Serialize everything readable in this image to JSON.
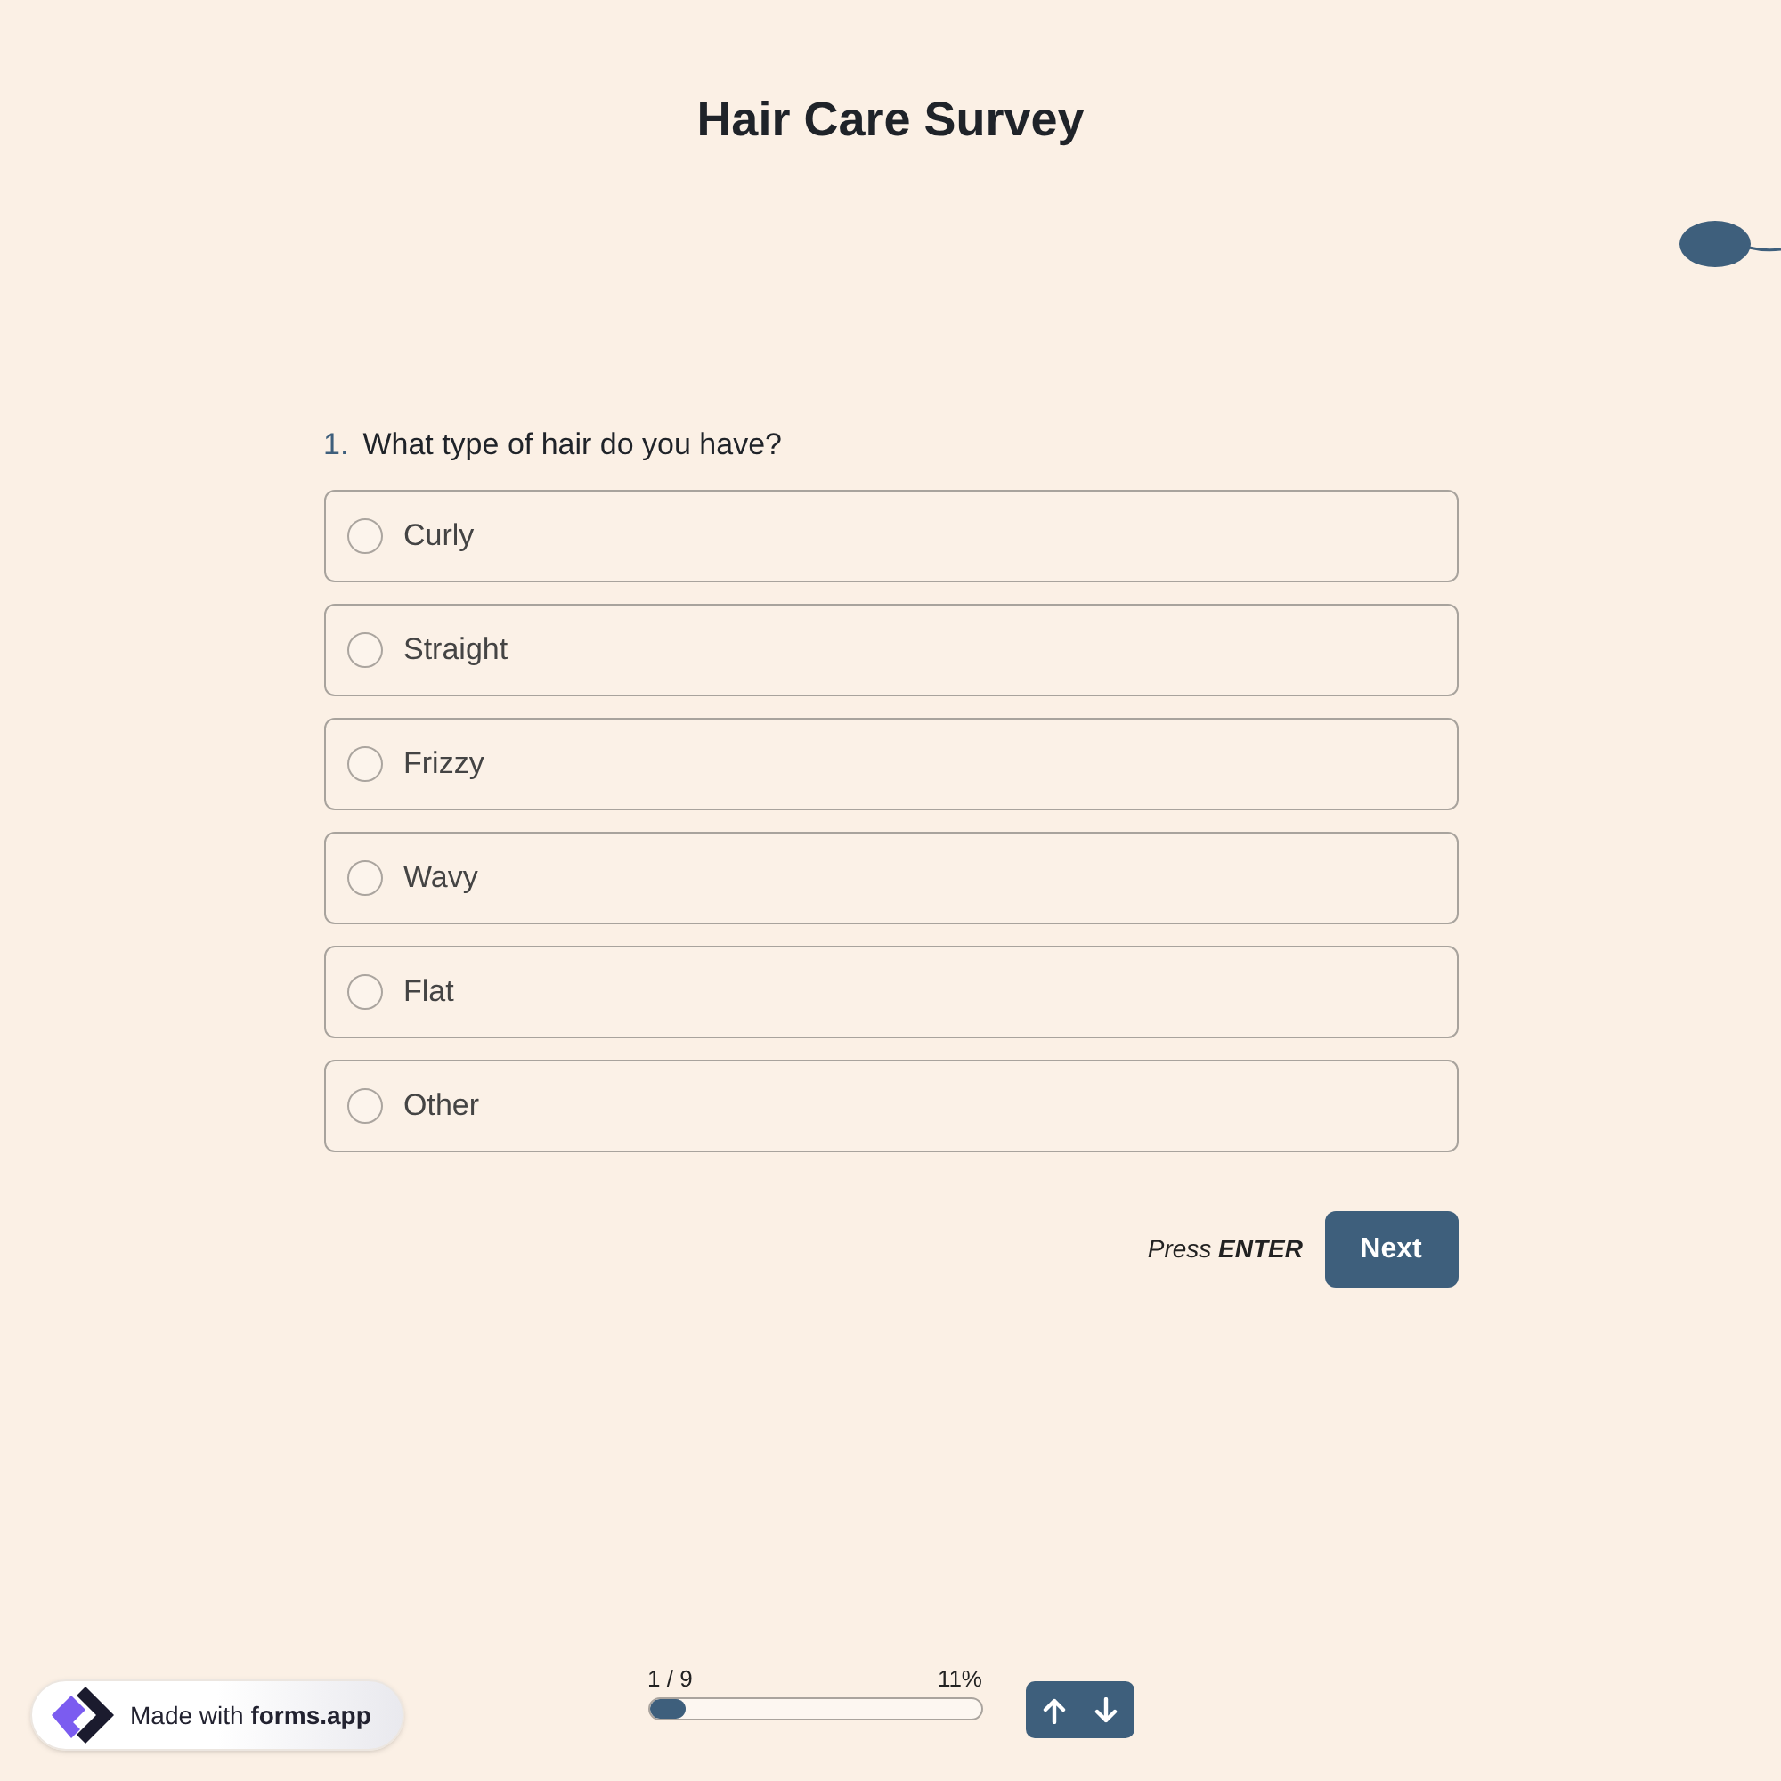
{
  "title": "Hair Care Survey",
  "question": {
    "number": "1.",
    "text": "What type of hair do you have?",
    "options": [
      {
        "label": "Curly",
        "selected": false
      },
      {
        "label": "Straight",
        "selected": false
      },
      {
        "label": "Frizzy",
        "selected": false
      },
      {
        "label": "Wavy",
        "selected": false
      },
      {
        "label": "Flat",
        "selected": false
      },
      {
        "label": "Other",
        "selected": false
      }
    ]
  },
  "submit": {
    "hint": "Press **ENTER**",
    "button": "Next"
  },
  "progress": {
    "count": "1 / 9",
    "percent": "11%",
    "level": 0.11
  },
  "badge": {
    "text": "Made with **forms.app**"
  }
}
